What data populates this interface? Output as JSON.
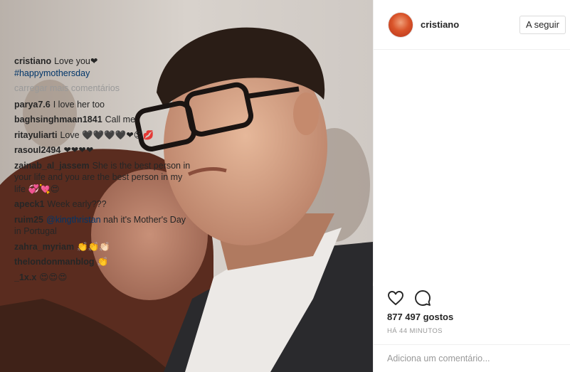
{
  "post": {
    "username": "cristiano",
    "follow_label": "A seguir",
    "caption": {
      "user": "cristiano",
      "text": "Love you❤",
      "hashtag": "#happymothersday"
    },
    "load_more": "carregar mais comentários",
    "comments": [
      {
        "user": "parya7.6",
        "text": "I love her too"
      },
      {
        "user": "baghsinghmaan1841",
        "text": "Call me"
      },
      {
        "user": "ritayuliarti",
        "text": "Love 🖤🖤🖤🖤❤😍💋"
      },
      {
        "user": "rasoul2494",
        "text": "❤❤❤❤"
      },
      {
        "user": "zainab_al_jassem",
        "text": "She is the best person in your life and you are the best person in my life 💞💘😍"
      },
      {
        "user": "apeck1",
        "text": "Week early???"
      },
      {
        "user": "ruim25",
        "mention": "@kingthristan",
        "text": "nah it's Mother's Day in Portugal"
      },
      {
        "user": "zahra_myriam",
        "text": "👏👏👏🏻"
      },
      {
        "user": "thelondonmanblog",
        "text": "👏"
      },
      {
        "user": "_1x.x",
        "text": "😍😍😍"
      }
    ],
    "likes": "877 497 gostos",
    "time": "HÁ 44 MINUTOS",
    "add_comment_placeholder": "Adiciona um comentário..."
  },
  "icons": {
    "like": "heart-icon",
    "comment": "comment-bubble-icon"
  }
}
